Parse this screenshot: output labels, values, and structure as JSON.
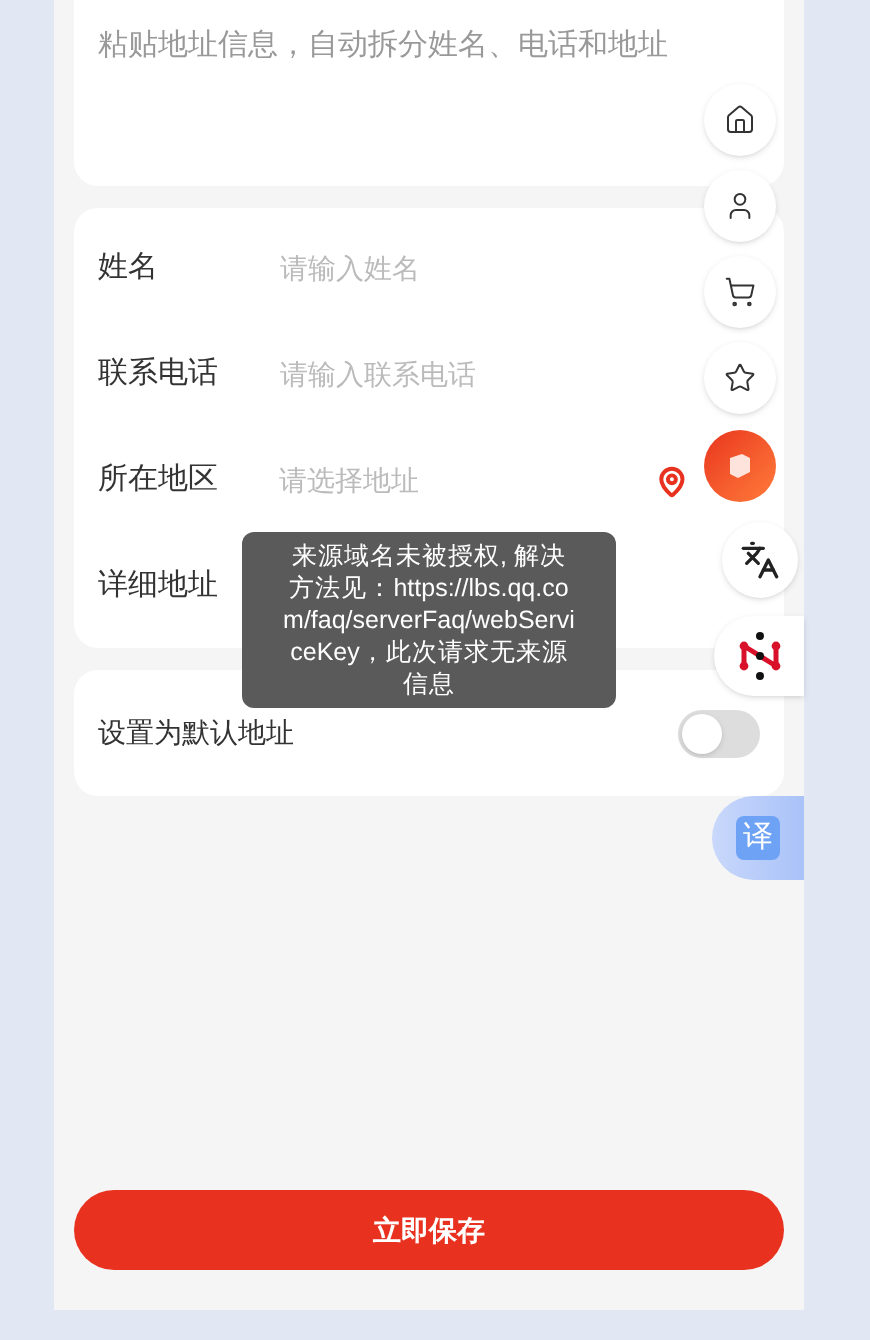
{
  "paste_box": {
    "placeholder": "粘贴地址信息，自动拆分姓名、电话和地址"
  },
  "fields": [
    {
      "label": "姓名",
      "placeholder": "请输入姓名",
      "kind": "text"
    },
    {
      "label": "联系电话",
      "placeholder": "请输入联系电话",
      "kind": "text"
    },
    {
      "label": "所在地区",
      "placeholder": "请选择地址",
      "kind": "picker"
    },
    {
      "label": "详细地址",
      "kind": "text"
    }
  ],
  "default_address": {
    "label": "设置为默认地址",
    "on": false
  },
  "save_button": {
    "label": "立即保存"
  },
  "tooltip": {
    "text": "来源域名未被授权, 解决方法见：https://lbs.qq.com/faq/serverFaq/webServiceKey，此次请求无来源信息"
  },
  "translate_button": {
    "label": "译"
  }
}
